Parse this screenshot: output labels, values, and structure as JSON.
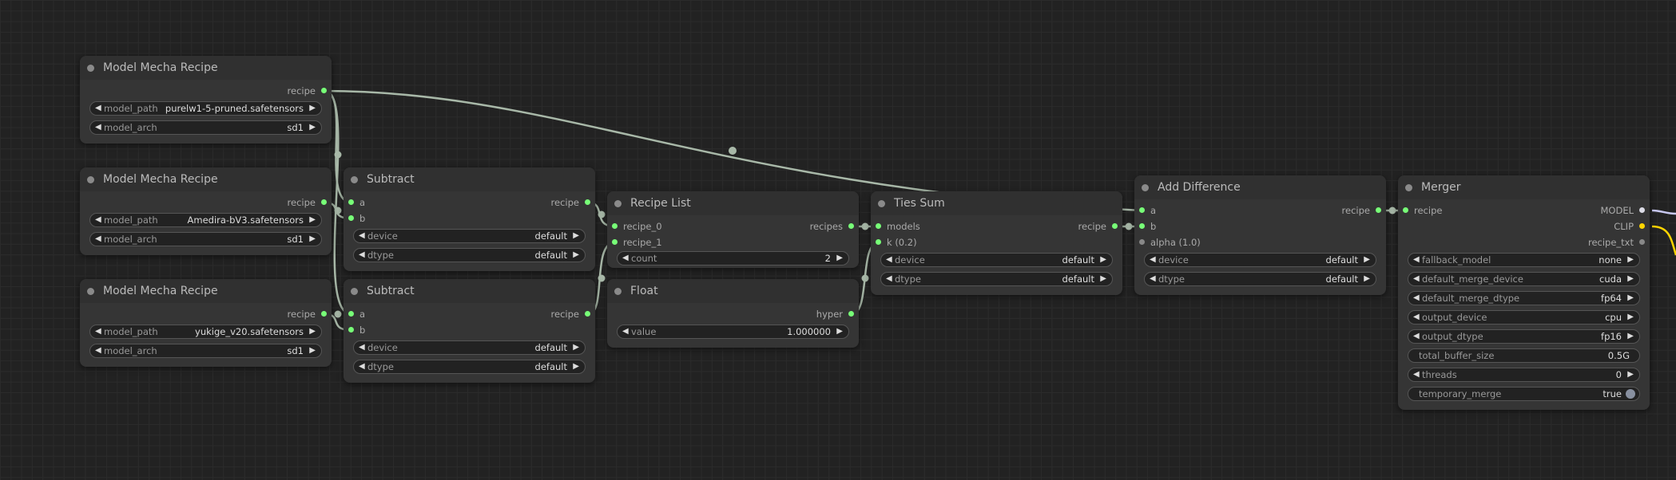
{
  "colors": {
    "background": "#222222",
    "node_body": "#353535",
    "node_header": "#303030",
    "link_default": "#a8b8a8",
    "link_model": "#c8c8f0",
    "link_clip": "#ffd500",
    "socket_active": "#77ff77"
  },
  "nodes": {
    "recipe1": {
      "title": "Model Mecha Recipe",
      "output": "recipe",
      "widgets": [
        {
          "label": "model_path",
          "value": "purelw1-5-pruned.safetensors"
        },
        {
          "label": "model_arch",
          "value": "sd1"
        }
      ]
    },
    "recipe2": {
      "title": "Model Mecha Recipe",
      "output": "recipe",
      "widgets": [
        {
          "label": "model_path",
          "value": "Amedira-bV3.safetensors"
        },
        {
          "label": "model_arch",
          "value": "sd1"
        }
      ]
    },
    "recipe3": {
      "title": "Model Mecha Recipe",
      "output": "recipe",
      "widgets": [
        {
          "label": "model_path",
          "value": "yukige_v20.safetensors"
        },
        {
          "label": "model_arch",
          "value": "sd1"
        }
      ]
    },
    "subtract1": {
      "title": "Subtract",
      "inputs": [
        "a",
        "b"
      ],
      "output": "recipe",
      "widgets": [
        {
          "label": "device",
          "value": "default"
        },
        {
          "label": "dtype",
          "value": "default"
        }
      ]
    },
    "subtract2": {
      "title": "Subtract",
      "inputs": [
        "a",
        "b"
      ],
      "output": "recipe",
      "widgets": [
        {
          "label": "device",
          "value": "default"
        },
        {
          "label": "dtype",
          "value": "default"
        }
      ]
    },
    "recipe_list": {
      "title": "Recipe List",
      "inputs": [
        "recipe_0",
        "recipe_1"
      ],
      "output": "recipes",
      "widgets": [
        {
          "label": "count",
          "value": "2"
        }
      ]
    },
    "float": {
      "title": "Float",
      "output": "hyper",
      "widgets": [
        {
          "label": "value",
          "value": "1.000000"
        }
      ]
    },
    "ties_sum": {
      "title": "Ties Sum",
      "inputs": [
        "models",
        "k (0.2)"
      ],
      "output": "recipe",
      "widgets": [
        {
          "label": "device",
          "value": "default"
        },
        {
          "label": "dtype",
          "value": "default"
        }
      ]
    },
    "add_difference": {
      "title": "Add Difference",
      "inputs": [
        "a",
        "b",
        "alpha (1.0)"
      ],
      "output": "recipe",
      "widgets": [
        {
          "label": "device",
          "value": "default"
        },
        {
          "label": "dtype",
          "value": "default"
        }
      ]
    },
    "merger": {
      "title": "Merger",
      "inputs": [
        "recipe"
      ],
      "outputs": [
        "MODEL",
        "CLIP",
        "recipe_txt"
      ],
      "widgets": [
        {
          "label": "fallback_model",
          "value": "none"
        },
        {
          "label": "default_merge_device",
          "value": "cuda"
        },
        {
          "label": "default_merge_dtype",
          "value": "fp64"
        },
        {
          "label": "output_device",
          "value": "cpu"
        },
        {
          "label": "output_dtype",
          "value": "fp16"
        },
        {
          "label": "total_buffer_size",
          "value": "0.5G"
        },
        {
          "label": "threads",
          "value": "0"
        },
        {
          "label": "temporary_merge",
          "value": "true"
        }
      ]
    }
  }
}
